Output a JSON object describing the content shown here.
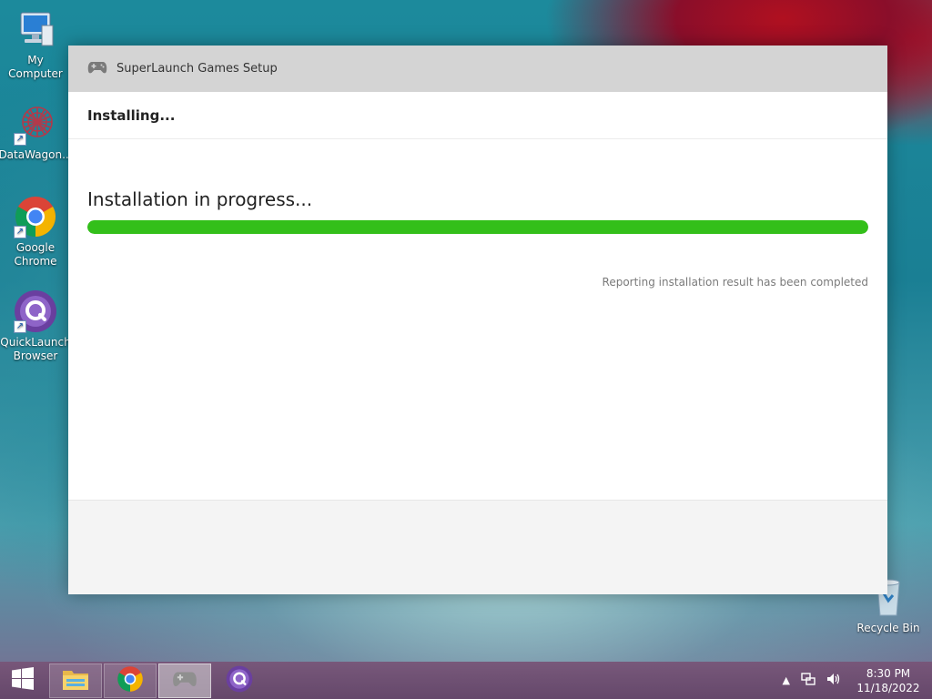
{
  "desktop": {
    "icons": [
      {
        "label": "My Computer",
        "icon": "computer-icon"
      },
      {
        "label": "DataWagon...",
        "icon": "datawagon-icon"
      },
      {
        "label": "Google\nChrome",
        "icon": "chrome-icon"
      },
      {
        "label": "QuickLaunch\nBrowser",
        "icon": "quicklaunch-icon"
      },
      {
        "label": "Recycle Bin",
        "icon": "recycle-bin-icon"
      }
    ]
  },
  "window": {
    "title": "SuperLaunch Games Setup",
    "icon": "gamepad-icon",
    "header": "Installing...",
    "progress_title": "Installation in progress...",
    "progress_fraction": 1.0,
    "status_text": "Reporting installation result has been completed",
    "accent_color": "#33bf1a"
  },
  "taskbar": {
    "start_icon": "windows-start-icon",
    "items": [
      {
        "name": "file-explorer",
        "icon": "folder-icon"
      },
      {
        "name": "google-chrome",
        "icon": "chrome-icon"
      },
      {
        "name": "superlaunch-setup",
        "icon": "gamepad-icon",
        "active": true
      },
      {
        "name": "quicklaunch-browser",
        "icon": "quicklaunch-icon"
      }
    ],
    "tray": {
      "time": "8:30 PM",
      "date": "11/18/2022"
    }
  }
}
